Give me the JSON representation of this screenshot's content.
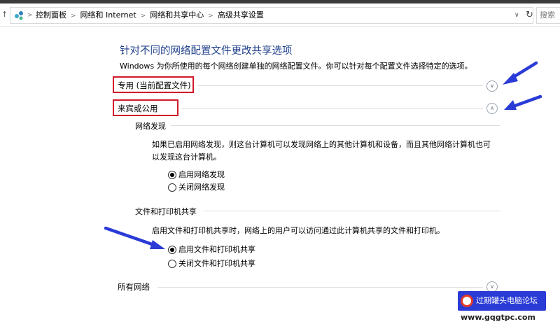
{
  "address_bar": {
    "crumbs": [
      "控制面板",
      "网络和 Internet",
      "网络和共享中心",
      "高级共享设置"
    ],
    "search_placeholder": "搜索"
  },
  "page": {
    "title": "针对不同的网络配置文件更改共享选项",
    "intro": "Windows 为你所使用的每个网络创建单独的网络配置文件。你可以针对每个配置文件选择特定的选项。"
  },
  "profiles": {
    "private": {
      "label": "专用 (当前配置文件)",
      "state": "collapsed"
    },
    "guest_public": {
      "label": "来宾或公用",
      "state": "expanded",
      "network_discovery": {
        "heading": "网络发现",
        "description": "如果已启用网络发现，则这台计算机可以发现网络上的其他计算机和设备，而且其他网络计算机也可以发现这台计算机。",
        "options": [
          {
            "label": "启用网络发现",
            "selected": true
          },
          {
            "label": "关闭网络发现",
            "selected": false
          }
        ]
      },
      "file_printer_sharing": {
        "heading": "文件和打印机共享",
        "description": "启用文件和打印机共享时，网络上的用户可以访问通过此计算机共享的文件和打印机。",
        "options": [
          {
            "label": "启用文件和打印机共享",
            "selected": true
          },
          {
            "label": "关闭文件和打印机共享",
            "selected": false
          }
        ]
      }
    },
    "all_networks": {
      "label": "所有网络",
      "state": "collapsed"
    }
  },
  "watermark": {
    "text": "过期罐头电脑论坛",
    "url": "www.gqgtpc.com"
  },
  "colors": {
    "title_blue": "#1e3f8a",
    "highlight_red": "#d11a2a",
    "arrow_blue": "#2a3bd6"
  },
  "icons": {
    "chevron_collapsed": "chevron-down-icon",
    "chevron_expanded": "chevron-up-icon"
  }
}
